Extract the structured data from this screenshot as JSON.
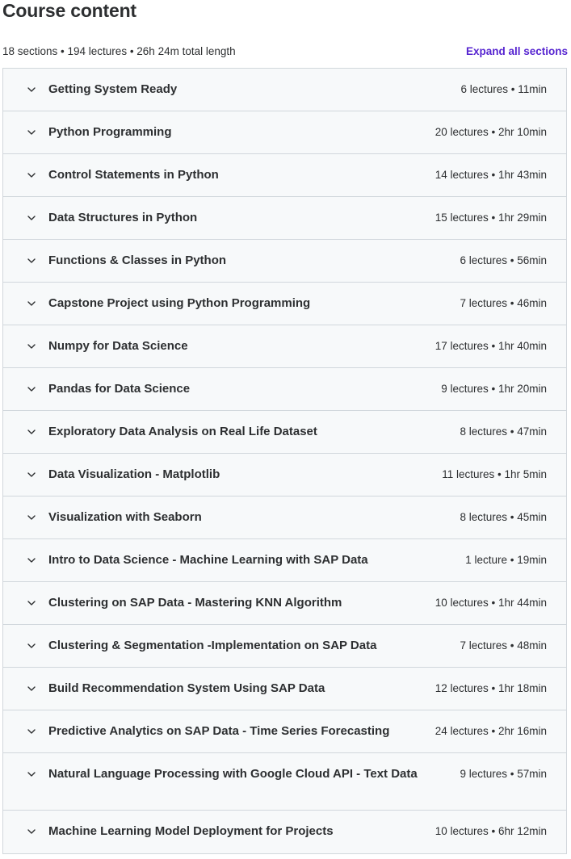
{
  "header": {
    "title": "Course content",
    "summary": "18 sections • 194 lectures • 26h 24m total length",
    "expand_all_label": "Expand all sections"
  },
  "icons": {
    "section_toggle": "chevron-down-icon"
  },
  "colors": {
    "text": "#2d2f31",
    "link": "#5624d0",
    "section_bg": "#f7f9fa",
    "border": "#d1d7dc"
  },
  "sections": [
    {
      "title": "Getting System Ready",
      "meta": "6 lectures • 11min"
    },
    {
      "title": "Python Programming",
      "meta": "20 lectures • 2hr 10min"
    },
    {
      "title": "Control Statements in Python",
      "meta": "14 lectures • 1hr 43min"
    },
    {
      "title": "Data Structures in Python",
      "meta": "15 lectures • 1hr 29min"
    },
    {
      "title": "Functions & Classes in Python",
      "meta": "6 lectures • 56min"
    },
    {
      "title": "Capstone Project using Python Programming",
      "meta": "7 lectures • 46min"
    },
    {
      "title": "Numpy for Data Science",
      "meta": "17 lectures • 1hr 40min"
    },
    {
      "title": "Pandas for Data Science",
      "meta": "9 lectures • 1hr 20min"
    },
    {
      "title": "Exploratory Data Analysis on Real Life Dataset",
      "meta": "8 lectures • 47min"
    },
    {
      "title": "Data Visualization - Matplotlib",
      "meta": "11 lectures • 1hr 5min"
    },
    {
      "title": "Visualization with Seaborn",
      "meta": "8 lectures • 45min"
    },
    {
      "title": "Intro to Data Science - Machine Learning with SAP Data",
      "meta": "1 lecture • 19min"
    },
    {
      "title": "Clustering on SAP Data - Mastering KNN Algorithm",
      "meta": "10 lectures • 1hr 44min"
    },
    {
      "title": "Clustering & Segmentation -Implementation on SAP Data",
      "meta": "7 lectures • 48min"
    },
    {
      "title": "Build Recommendation System Using SAP Data",
      "meta": "12 lectures • 1hr 18min"
    },
    {
      "title": "Predictive Analytics on SAP Data - Time Series Forecasting",
      "meta": "24 lectures • 2hr 16min"
    },
    {
      "title": "Natural Language Processing with Google Cloud API - Text Data",
      "meta": "9 lectures • 57min"
    },
    {
      "title": "Machine Learning Model Deployment for Projects",
      "meta": "10 lectures • 6hr 12min"
    }
  ]
}
